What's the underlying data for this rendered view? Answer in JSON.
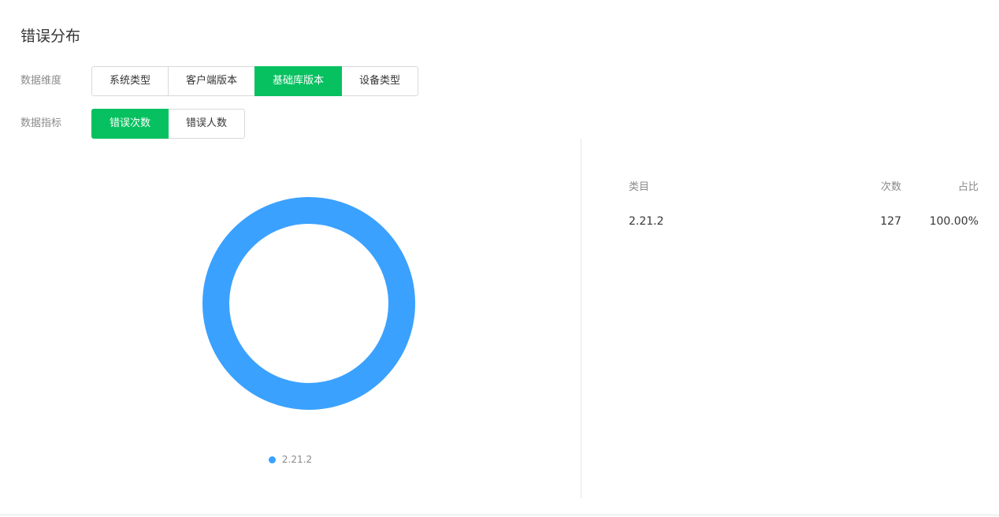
{
  "title": "错误分布",
  "filters": {
    "dimension": {
      "label": "数据维度",
      "options": [
        "系统类型",
        "客户端版本",
        "基础库版本",
        "设备类型"
      ],
      "selected_index": 2
    },
    "metric": {
      "label": "数据指标",
      "options": [
        "错误次数",
        "错误人数"
      ],
      "selected_index": 0
    }
  },
  "table": {
    "headers": {
      "category": "类目",
      "count": "次数",
      "ratio": "占比"
    },
    "rows": [
      {
        "category": "2.21.2",
        "count": "127",
        "ratio": "100.00%"
      }
    ]
  },
  "chart_data": {
    "type": "pie",
    "donut": true,
    "categories": [
      "2.21.2"
    ],
    "values": [
      127
    ],
    "colors": [
      "#3ba1ff"
    ],
    "legend_position": "bottom"
  },
  "colors": {
    "accent": "#07c160",
    "series": "#3ba1ff"
  }
}
